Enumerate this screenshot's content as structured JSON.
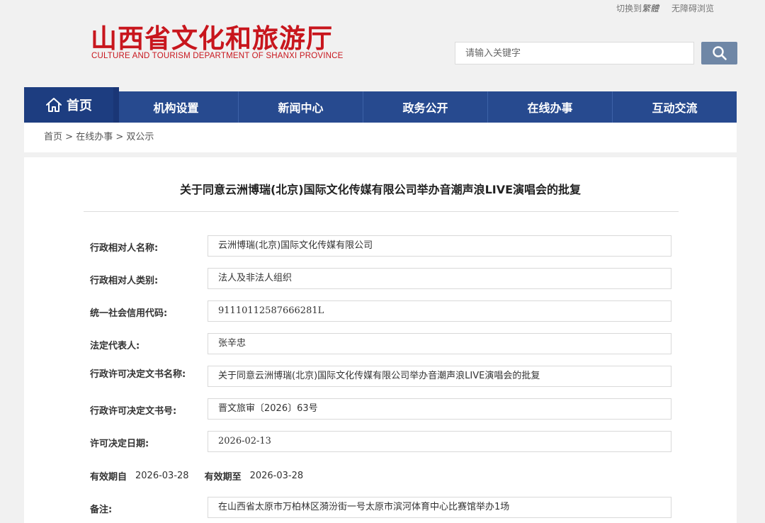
{
  "top_links": {
    "switch_prefix": "切换到",
    "switch_target": "繁體",
    "accessibility": "无障碍浏览"
  },
  "logo": {
    "cn": "山西省文化和旅游厅",
    "en": "CULTURE AND TOURISM DEPARTMENT OF SHANXI PROVINCE"
  },
  "search": {
    "placeholder": "请输入关键字"
  },
  "nav": {
    "home": "首页",
    "items": [
      "机构设置",
      "新闻中心",
      "政务公开",
      "在线办事",
      "互动交流"
    ]
  },
  "breadcrumb": {
    "items": [
      "首页",
      "在线办事",
      "双公示"
    ],
    "separator": " > "
  },
  "document": {
    "title": "关于同意云洲博瑞(北京)国际文化传媒有限公司举办音潮声浪LIVE演唱会的批复",
    "rows": [
      {
        "label": "行政相对人名称:",
        "value": "云洲博瑞(北京)国际文化传媒有限公司"
      },
      {
        "label": "行政相对人类别:",
        "value": "法人及非法人组织"
      },
      {
        "label": "统一社会信用代码:",
        "value": "91110112587666281L"
      },
      {
        "label": "法定代表人:",
        "value": "张辛忠"
      },
      {
        "label": "行政许可决定文书名称:",
        "value": "关于同意云洲博瑞(北京)国际文化传媒有限公司举办音潮声浪LIVE演唱会的批复"
      },
      {
        "label": "行政许可决定文书号:",
        "value": "晋文旅审〔2026〕63号"
      },
      {
        "label": "许可决定日期:",
        "value": "2026-02-13"
      }
    ],
    "validity": {
      "from_label": "有效期自",
      "from_value": "2026-03-28",
      "to_label": "有效期至",
      "to_value": "2026-03-28"
    },
    "remark": {
      "label": "备注:",
      "value": "在山西省太原市万柏林区漪汾街一号太原市滨河体育中心比赛馆举办1场"
    }
  },
  "colors": {
    "brand_red": "#c8161d",
    "nav_blue": "#274a8f",
    "nav_home_blue": "#1d3d80",
    "search_button": "#6f87a6"
  }
}
